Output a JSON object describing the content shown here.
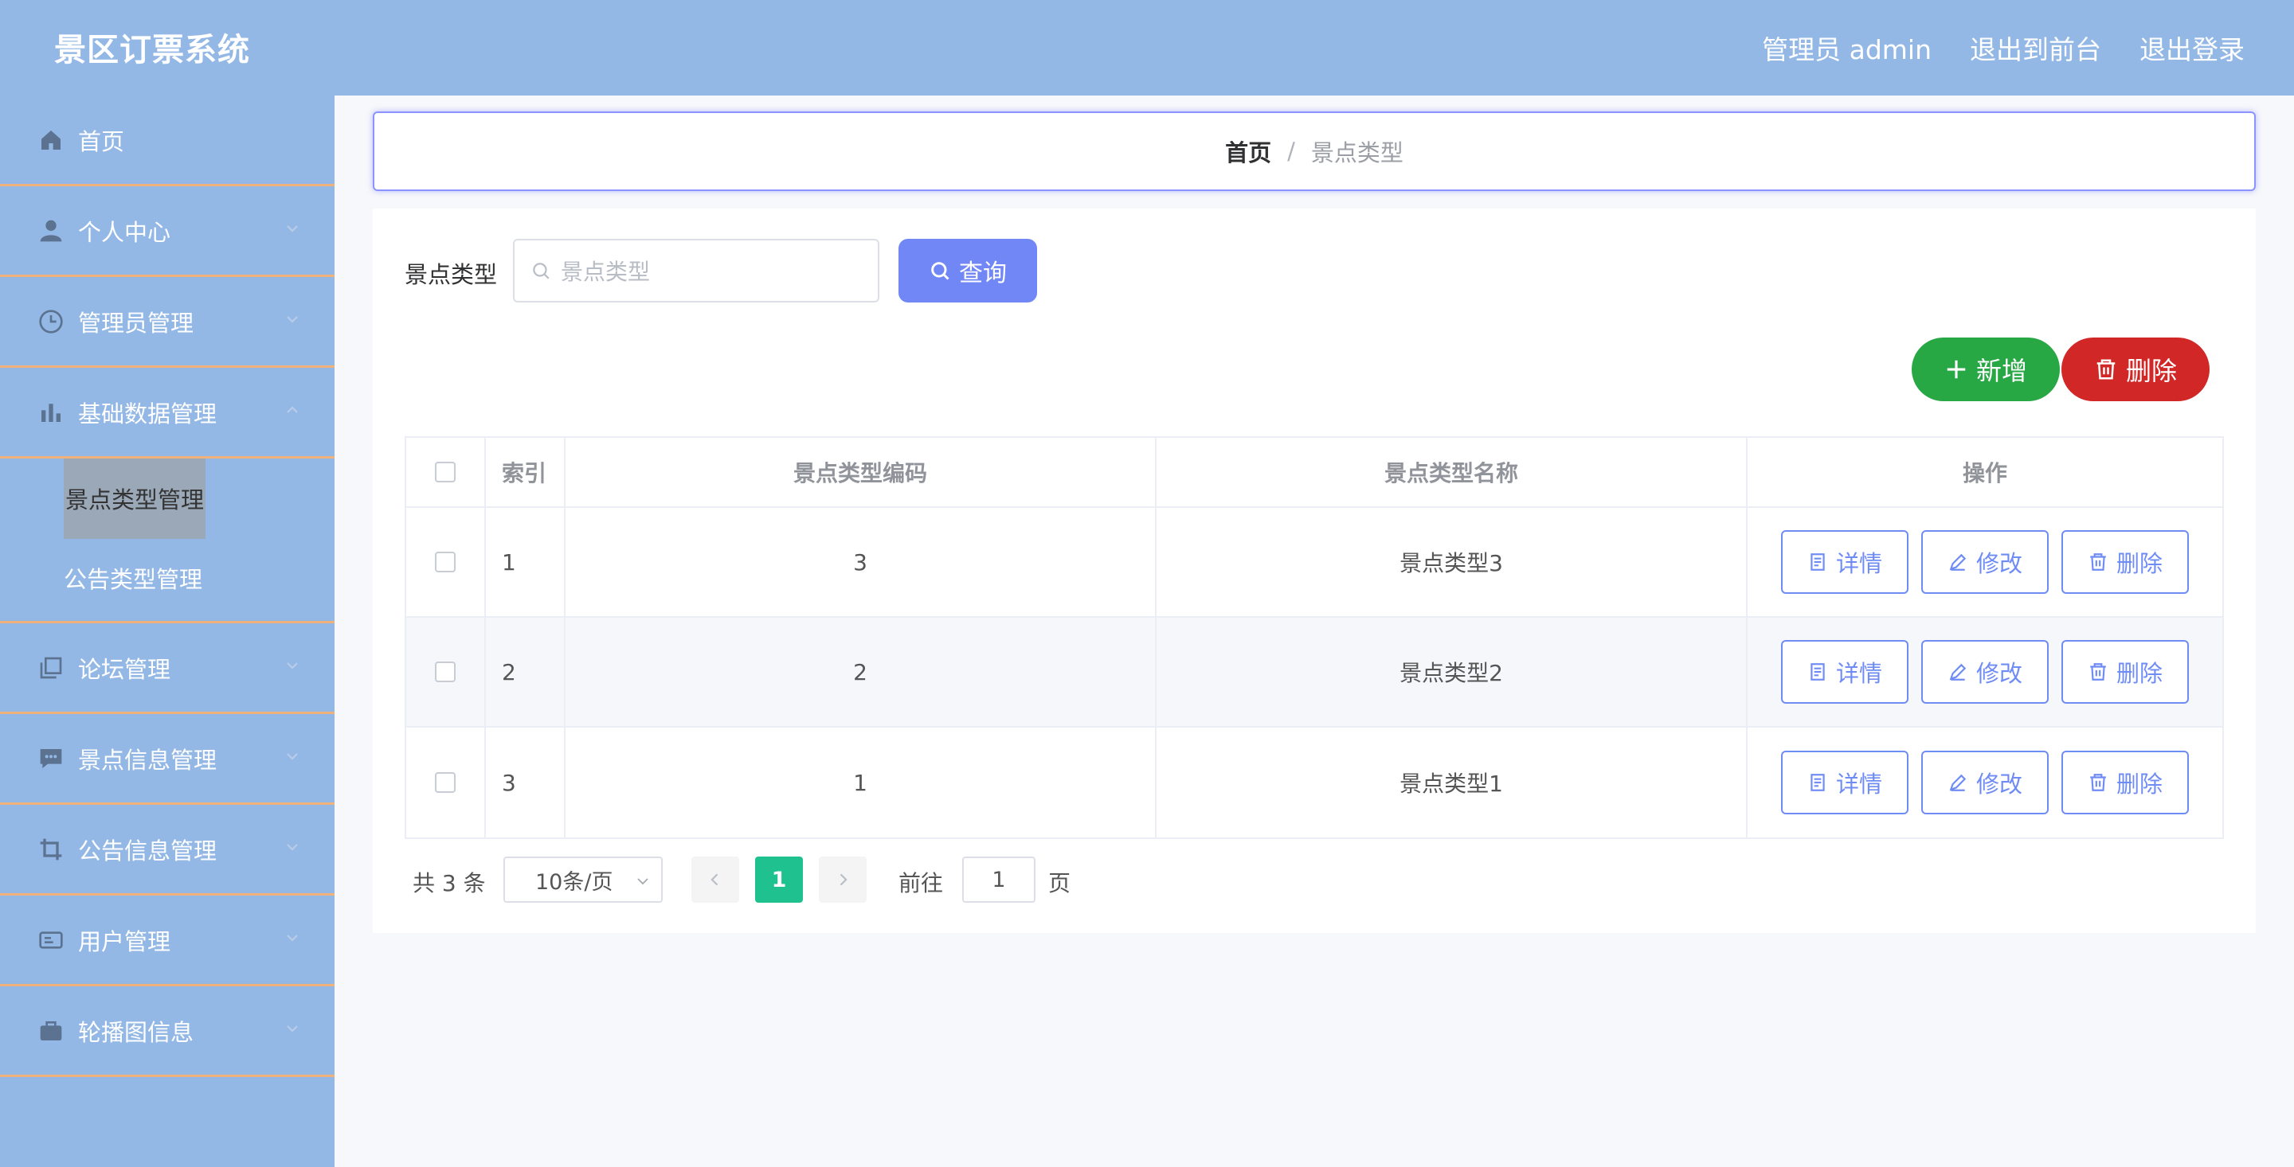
{
  "header": {
    "title": "景区订票系统",
    "user_label": "管理员 admin",
    "exit_front": "退出到前台",
    "logout": "退出登录"
  },
  "sidebar": {
    "items": [
      {
        "label": "首页",
        "icon": "home-icon"
      },
      {
        "label": "个人中心",
        "icon": "user-icon"
      },
      {
        "label": "管理员管理",
        "icon": "clock-icon"
      },
      {
        "label": "基础数据管理",
        "icon": "bar-chart-icon"
      },
      {
        "label": "论坛管理",
        "icon": "copy-icon"
      },
      {
        "label": "景点信息管理",
        "icon": "chat-icon"
      },
      {
        "label": "公告信息管理",
        "icon": "crop-icon"
      },
      {
        "label": "用户管理",
        "icon": "card-icon"
      },
      {
        "label": "轮播图信息",
        "icon": "briefcase-icon"
      }
    ],
    "submenu": [
      {
        "label": "景点类型管理"
      },
      {
        "label": "公告类型管理"
      }
    ]
  },
  "breadcrumb": {
    "home": "首页",
    "separator": "/",
    "current": "景点类型"
  },
  "search": {
    "label": "景点类型",
    "placeholder": "景点类型",
    "query_button": "查询"
  },
  "actions": {
    "add": "新增",
    "delete": "删除"
  },
  "table": {
    "headers": {
      "index": "索引",
      "code": "景点类型编码",
      "name": "景点类型名称",
      "ops": "操作"
    },
    "rows": [
      {
        "index": "1",
        "code": "3",
        "name": "景点类型3"
      },
      {
        "index": "2",
        "code": "2",
        "name": "景点类型2"
      },
      {
        "index": "3",
        "code": "1",
        "name": "景点类型1"
      }
    ],
    "row_actions": {
      "detail": "详情",
      "edit": "修改",
      "delete": "删除"
    }
  },
  "pagination": {
    "total": "共 3 条",
    "page_size": "10条/页",
    "current_page": "1",
    "goto_label": "前往",
    "goto_value": "1",
    "page_unit": "页"
  },
  "colors": {
    "sidebar_bg": "#94b8e5",
    "accent": "#7287f6",
    "add_green": "#28a745",
    "delete_red": "#d22727",
    "page_active": "#1fc18e",
    "divider": "#f0b27a"
  }
}
